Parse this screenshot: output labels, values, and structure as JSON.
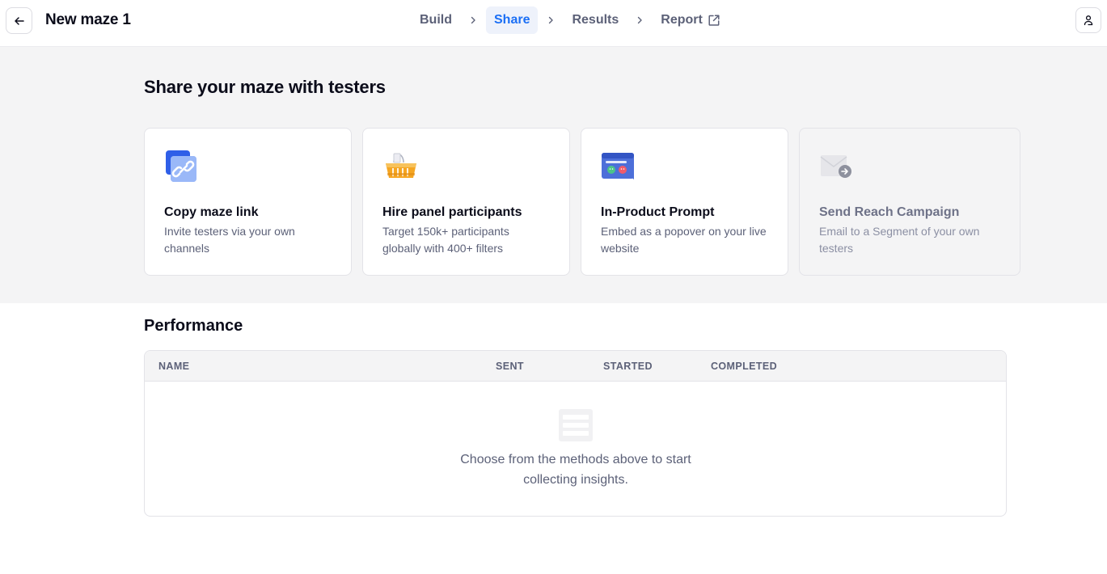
{
  "header": {
    "title": "New maze 1",
    "steps": [
      {
        "label": "Build"
      },
      {
        "label": "Share"
      },
      {
        "label": "Results"
      },
      {
        "label": "Report"
      }
    ],
    "active_step": "Share"
  },
  "share": {
    "heading": "Share your maze with testers",
    "cards": [
      {
        "title": "Copy maze link",
        "desc": "Invite testers via your own channels",
        "icon": "link-icon"
      },
      {
        "title": "Hire panel participants",
        "desc": "Target 150k+ participants globally with 400+ filters",
        "icon": "basket-icon"
      },
      {
        "title": "In-Product Prompt",
        "desc": "Embed as a popover on your live website",
        "icon": "prompt-icon"
      },
      {
        "title": "Send Reach Campaign",
        "desc": "Email to a Segment of your own testers",
        "icon": "mail-icon"
      }
    ]
  },
  "performance": {
    "heading": "Performance",
    "columns": [
      "NAME",
      "SENT",
      "STARTED",
      "COMPLETED"
    ],
    "empty_text": "Choose from the methods above to start collecting insights."
  },
  "colors": {
    "accent": "#1b6ff5",
    "section_bg": "#f4f4f5"
  }
}
